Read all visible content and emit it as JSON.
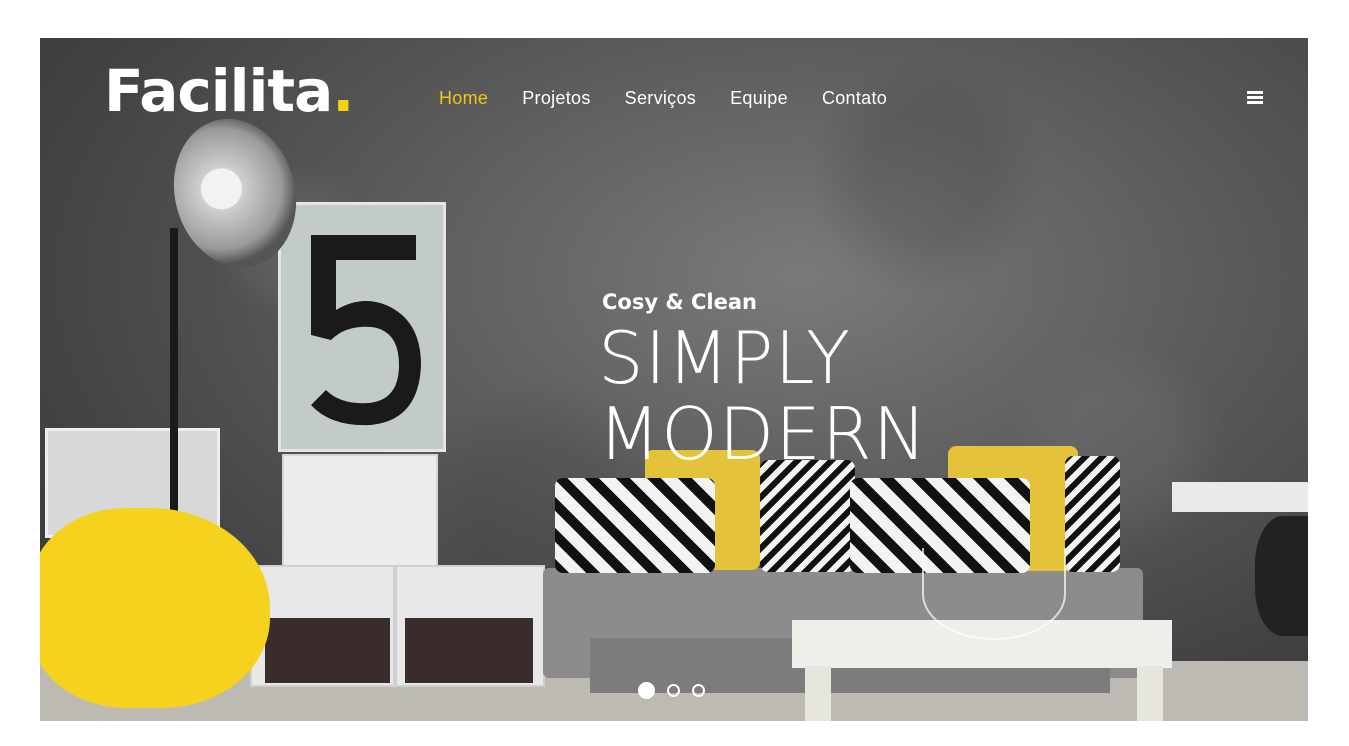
{
  "brand": {
    "name": "Facilita",
    "dot": "."
  },
  "nav": {
    "items": [
      {
        "label": "Home",
        "active": true
      },
      {
        "label": "Projetos",
        "active": false
      },
      {
        "label": "Serviços",
        "active": false
      },
      {
        "label": "Equipe",
        "active": false
      },
      {
        "label": "Contato",
        "active": false
      }
    ],
    "menu_icon": "hamburger-icon"
  },
  "hero": {
    "kicker": "Cosy & Clean",
    "headline_line1": "SIMPLY",
    "headline_line2": "MODERN",
    "slides_total": 3,
    "active_slide": 1
  },
  "colors": {
    "accent": "#f3c614",
    "text": "#ffffff"
  }
}
